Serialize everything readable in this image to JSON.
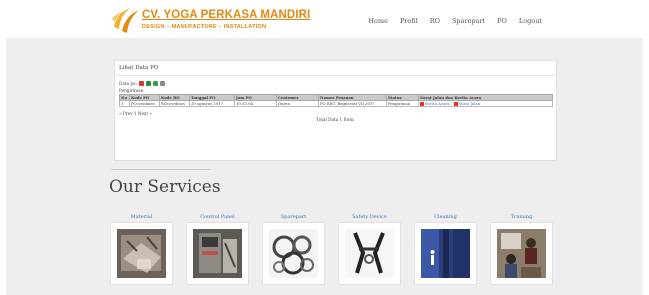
{
  "header": {
    "company_name": "CV. YOGA PERKASA MANDIRI",
    "tagline": "DESIGN – MANUFACTURE – INSTALLATION",
    "nav": [
      "Home",
      "Profil",
      "RO",
      "Sparepart",
      "PO",
      "Logout"
    ]
  },
  "panel": {
    "title": "Lihat Data PO",
    "data_label": "Data po:",
    "subtitle": "Pengiriman",
    "columns": [
      "No",
      "Kode PO",
      "Kode RO",
      "Tanggal PO",
      "Jam PO",
      "Customer",
      "Nomor Pesanan",
      "Status",
      "Surat Jalan dan Berita Acara"
    ],
    "rows": [
      {
        "no": "1",
        "kode_po": "POcowdmes",
        "kode_ro": "ROcowdmes",
        "tanggal": "29 agustus 2017",
        "jam": "10.53.04",
        "customer": "Duren",
        "nomor": "PO REG_Registrasi VII 2017",
        "status": "Pengiriman",
        "doc1": "Berita Acara",
        "doc2": "Surat Jalan"
      }
    ],
    "pager": "« Prev 1 Next »",
    "total": "Total Data 1 Item."
  },
  "services": {
    "title": "Our Services",
    "items": [
      {
        "label": "Material",
        "icon": "material-photo"
      },
      {
        "label": "Control Panel",
        "icon": "control-panel-photo"
      },
      {
        "label": "Sparepart",
        "icon": "sparepart-photo"
      },
      {
        "label": "Safety Device",
        "icon": "safety-device-photo"
      },
      {
        "label": "Cleaning",
        "icon": "cleaning-photo"
      },
      {
        "label": "Training",
        "icon": "training-photo"
      }
    ]
  },
  "colors": {
    "brand": "#e08a12",
    "link": "#3a6fc4",
    "section_bg": "#eeeeee"
  }
}
